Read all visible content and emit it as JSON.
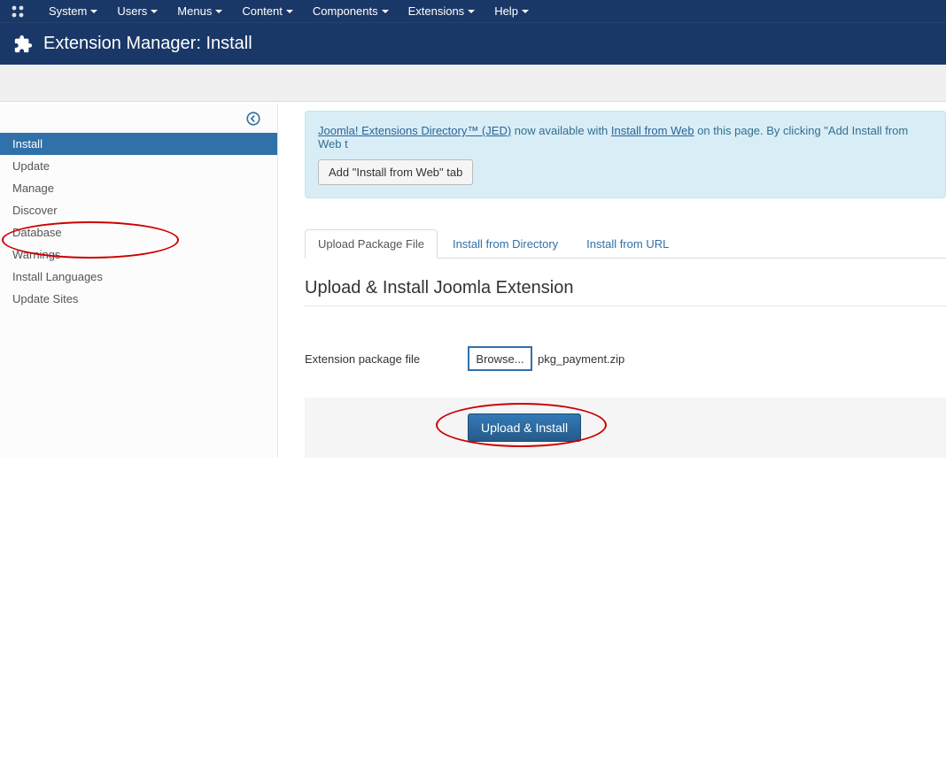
{
  "topbar": {
    "items": [
      {
        "label": "System"
      },
      {
        "label": "Users"
      },
      {
        "label": "Menus"
      },
      {
        "label": "Content"
      },
      {
        "label": "Components"
      },
      {
        "label": "Extensions"
      },
      {
        "label": "Help"
      }
    ]
  },
  "header": {
    "title": "Extension Manager: Install"
  },
  "sidebar": {
    "items": [
      {
        "label": "Install",
        "active": true
      },
      {
        "label": "Update"
      },
      {
        "label": "Manage"
      },
      {
        "label": "Discover"
      },
      {
        "label": "Database"
      },
      {
        "label": "Warnings"
      },
      {
        "label": "Install Languages"
      },
      {
        "label": "Update Sites"
      }
    ]
  },
  "alert": {
    "link1": "Joomla! Extensions Directory™ (JED)",
    "mid1": " now available with ",
    "link2": "Install from Web",
    "mid2": " on this page.  By clicking \"Add Install from Web t",
    "button": "Add \"Install from Web\" tab"
  },
  "tabs": {
    "items": [
      {
        "label": "Upload Package File",
        "active": true
      },
      {
        "label": "Install from Directory"
      },
      {
        "label": "Install from URL"
      }
    ]
  },
  "panel": {
    "title": "Upload & Install Joomla Extension",
    "label": "Extension package file",
    "browse": "Browse...",
    "filename": "pkg_payment.zip",
    "submit": "Upload & Install"
  }
}
